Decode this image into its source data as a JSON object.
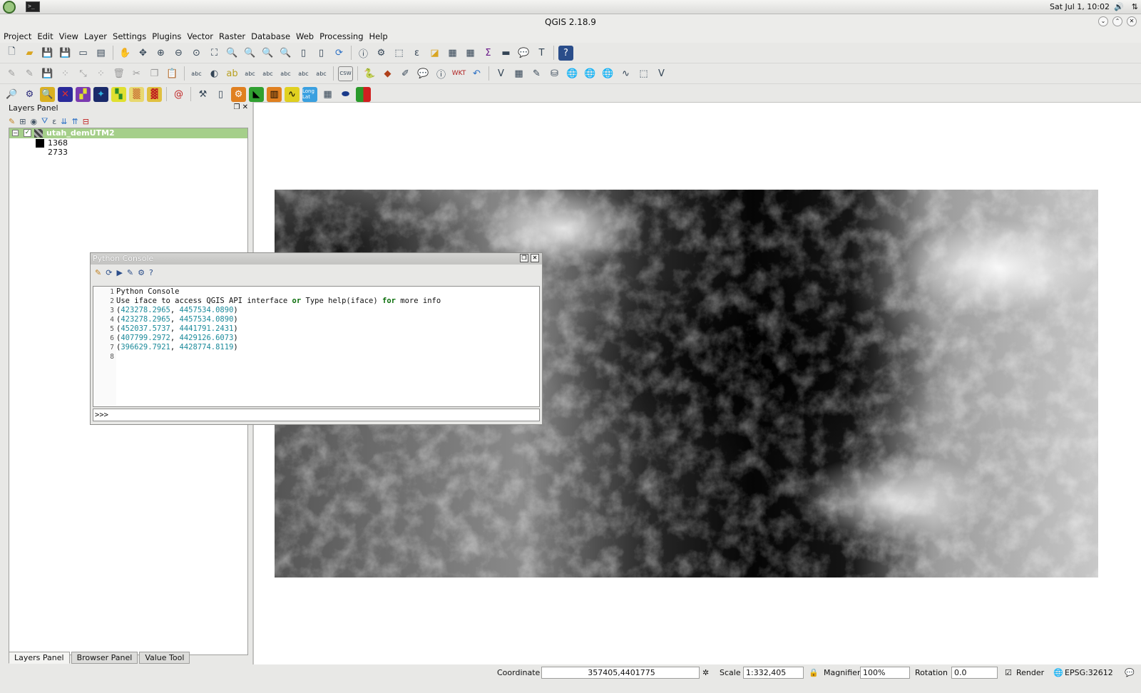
{
  "system": {
    "clock": "Sat Jul  1, 10:02"
  },
  "window": {
    "title": "QGIS 2.18.9"
  },
  "menu": [
    "Project",
    "Edit",
    "View",
    "Layer",
    "Settings",
    "Plugins",
    "Vector",
    "Raster",
    "Database",
    "Web",
    "Processing",
    "Help"
  ],
  "layers_panel": {
    "title": "Layers Panel",
    "layer_name": "utah_demUTM2",
    "legend_high": "1368",
    "legend_low": "2733",
    "tabs": [
      "Layers Panel",
      "Browser Panel",
      "Value Tool"
    ]
  },
  "python_console": {
    "title": "Python Console",
    "lines": [
      {
        "n": "1",
        "text": "Python Console"
      },
      {
        "n": "2",
        "pre": "Use iface to access QGIS API interface ",
        "kw1": "or",
        "mid": " Type help(iface) ",
        "kw2": "for",
        "post": " more info"
      },
      {
        "n": "3",
        "a": "423278.2965",
        "b": "4457534.0890"
      },
      {
        "n": "4",
        "a": "423278.2965",
        "b": "4457534.0890"
      },
      {
        "n": "5",
        "a": "452037.5737",
        "b": "4441791.2431"
      },
      {
        "n": "6",
        "a": "407799.2972",
        "b": "4429126.6073"
      },
      {
        "n": "7",
        "a": "396629.7921",
        "b": "4428774.8119"
      },
      {
        "n": "8",
        "text": ""
      }
    ],
    "prompt": ">>>"
  },
  "status": {
    "coordinate_label": "Coordinate",
    "coordinate_value": "357405,4401775",
    "scale_label": "Scale",
    "scale_value": "1:332,405",
    "magnifier_label": "Magnifier",
    "magnifier_value": "100%",
    "rotation_label": "Rotation",
    "rotation_value": "0.0",
    "render_label": "Render",
    "crs": "EPSG:32612"
  }
}
